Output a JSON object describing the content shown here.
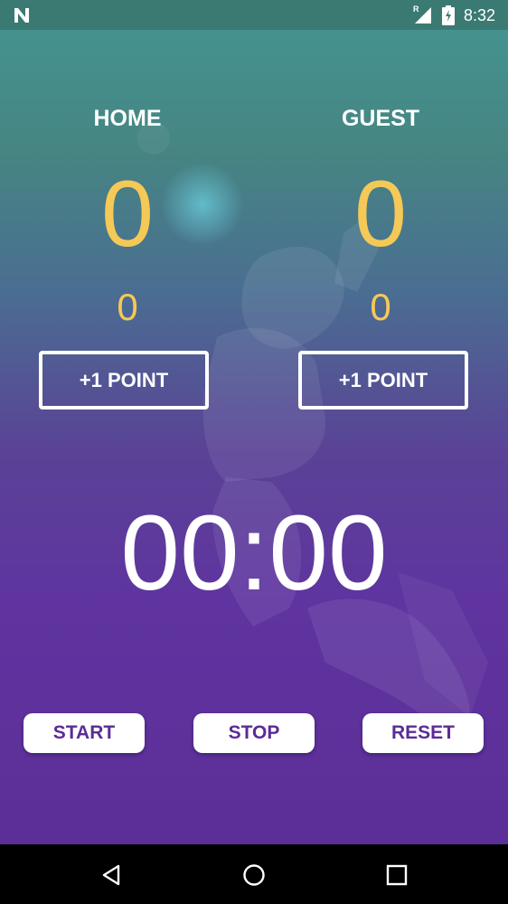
{
  "status_bar": {
    "app_icon": "n-logo-icon",
    "signal_letter": "R",
    "time": "8:32"
  },
  "home": {
    "label": "HOME",
    "score": "0",
    "sub": "0",
    "button": "+1 POINT"
  },
  "guest": {
    "label": "GUEST",
    "score": "0",
    "sub": "0",
    "button": "+1 POINT"
  },
  "timer": {
    "display": "00:00"
  },
  "controls": {
    "start": "START",
    "stop": "STOP",
    "reset": "RESET"
  },
  "nav": {
    "back": "back-icon",
    "home": "home-icon",
    "recents": "recents-icon"
  },
  "colors": {
    "score": "#f5c957",
    "accent": "#5b2c95",
    "status_bar": "#3a7a73"
  }
}
